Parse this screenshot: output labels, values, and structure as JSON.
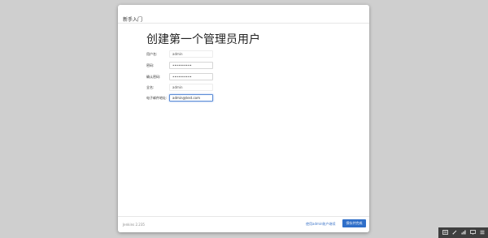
{
  "wizard": {
    "header_title": "新手入门",
    "page_title": "创建第一个管理员用户",
    "fields": [
      {
        "label": "用户名:",
        "value": "admin",
        "placeholder": ""
      },
      {
        "label": "密码:",
        "value": "••••••••••",
        "placeholder": ""
      },
      {
        "label": "确认密码:",
        "value": "••••••••••",
        "placeholder": ""
      },
      {
        "label": "全名:",
        "value": "admin",
        "placeholder": ""
      },
      {
        "label": "电子邮件地址:",
        "value": "admin@test.com",
        "placeholder": ""
      }
    ],
    "footer": {
      "version": "Jenkins 2.235",
      "use_admin_link": "使用admin账户继续",
      "install_button": "保存并完成"
    }
  },
  "taskbar": {
    "icons": [
      "keyboard-icon",
      "pen-icon",
      "network-icon",
      "display-icon",
      "menu-icon"
    ]
  },
  "colors": {
    "background": "#cfcfcf",
    "accent": "#2f6fc9",
    "link": "#3a73c7"
  }
}
